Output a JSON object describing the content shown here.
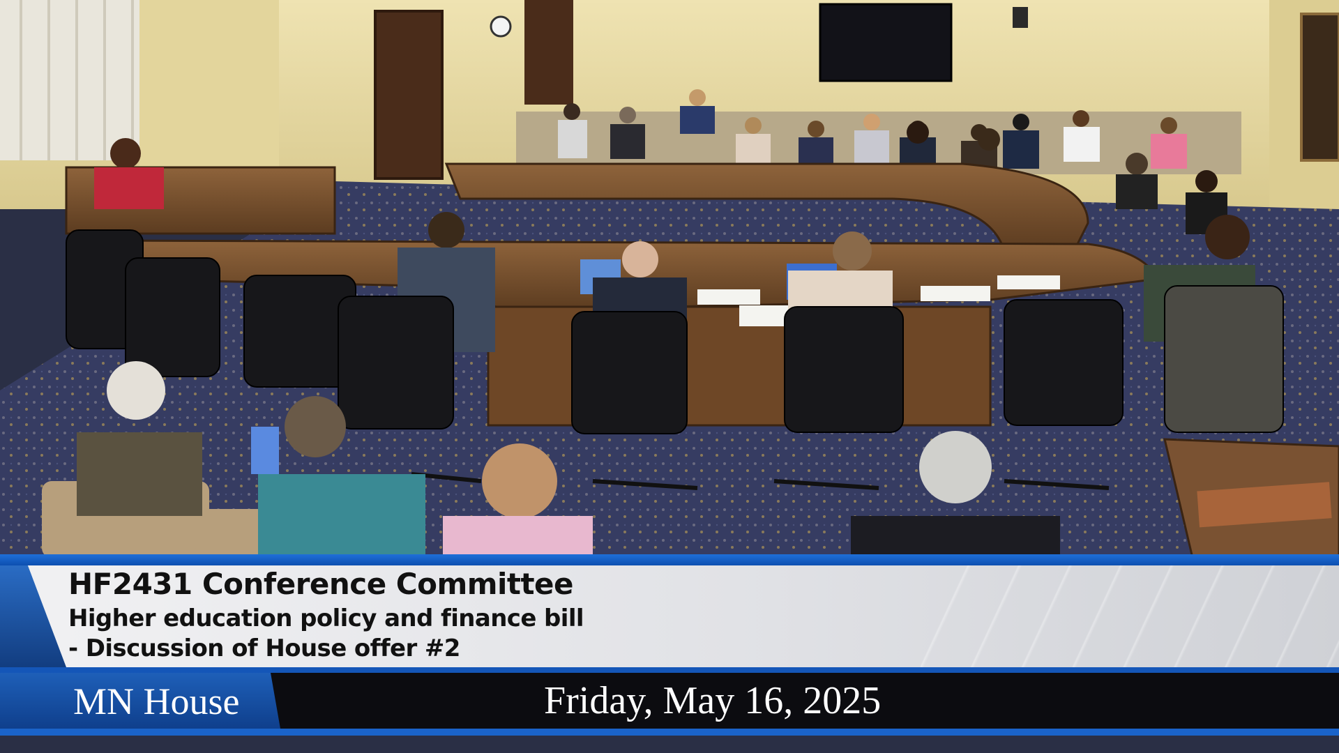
{
  "banner": {
    "title": "HF2431 Conference Committee",
    "subtitle_line1": "Higher education policy and finance bill",
    "subtitle_line2": "- Discussion of House offer #2",
    "organization": "MN House",
    "date": "Friday, May 16, 2025"
  },
  "colors": {
    "banner_blue": "#1456b8",
    "banner_panel": "#e6e7ea",
    "date_bar": "#0c0c10",
    "wall": "#e8dca6",
    "carpet": "#3a4066",
    "wood": "#7a5230"
  }
}
